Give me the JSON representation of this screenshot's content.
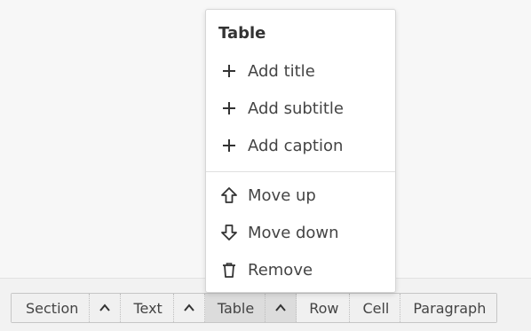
{
  "menu": {
    "title": "Table",
    "items": [
      {
        "label": "Add title",
        "icon": "plus-icon"
      },
      {
        "label": "Add subtitle",
        "icon": "plus-icon"
      },
      {
        "label": "Add caption",
        "icon": "plus-icon"
      },
      {
        "label": "Move up",
        "icon": "arrow-up-icon"
      },
      {
        "label": "Move down",
        "icon": "arrow-down-icon"
      },
      {
        "label": "Remove",
        "icon": "trash-icon"
      }
    ]
  },
  "breadcrumb": {
    "items": [
      {
        "label": "Section"
      },
      {
        "label": "Text"
      },
      {
        "label": "Table"
      },
      {
        "label": "Row"
      },
      {
        "label": "Cell"
      },
      {
        "label": "Paragraph"
      }
    ],
    "active_index": 2
  },
  "colors": {
    "background": "#f7f7f7",
    "menu_background": "#ffffff",
    "active_crumb": "#dcdcdc",
    "text": "#444444"
  }
}
